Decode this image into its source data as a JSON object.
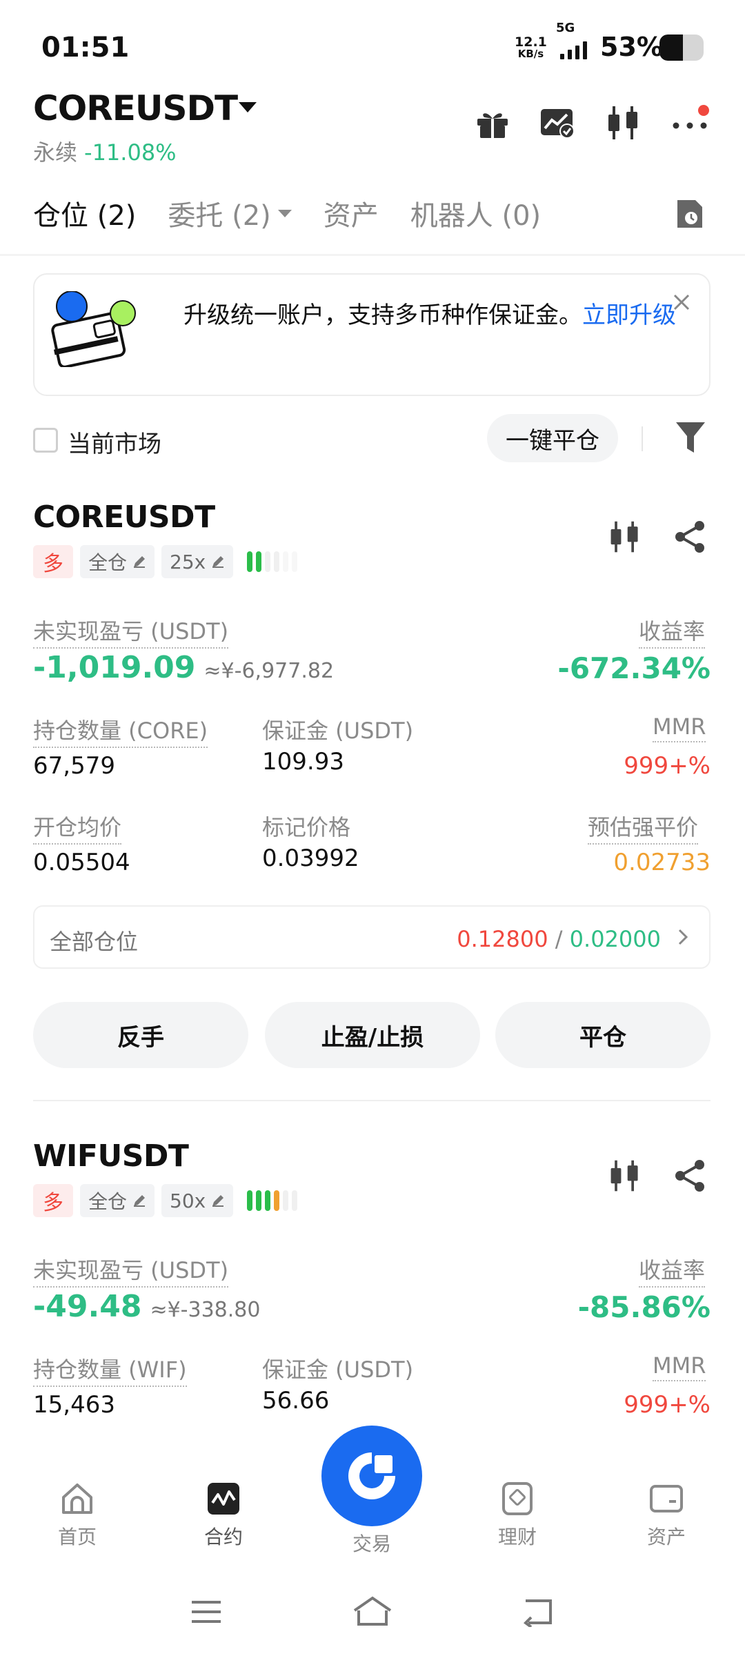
{
  "status_bar": {
    "time": "01:51",
    "net_speed_value": "12.1",
    "net_speed_unit": "KB/s",
    "network": "5G",
    "battery": "53%",
    "battery_level": 0.53
  },
  "header": {
    "pair": "COREUSDT",
    "contract_type": "永续",
    "change": "-11.08%"
  },
  "tabs": {
    "positions": "仓位 (2)",
    "orders": "委托 (2)",
    "assets": "资产",
    "bots": "机器人 (0)"
  },
  "banner": {
    "text": "升级统一账户，支持多币种作保证金。",
    "link": "立即升级"
  },
  "filter": {
    "current_market": "当前市场",
    "close_all": "一键平仓"
  },
  "positions": [
    {
      "symbol": "COREUSDT",
      "side": "多",
      "margin_mode": "全仓",
      "leverage": "25x",
      "risk_bars": 2,
      "unrealized_pnl_label": "未实现盈亏 (USDT)",
      "unrealized_pnl": "-1,019.09",
      "unrealized_pnl_cny": "≈¥-6,977.82",
      "roe_label": "收益率",
      "roe": "-672.34%",
      "qty_label": "持仓数量 (CORE)",
      "qty": "67,579",
      "margin_label": "保证金 (USDT)",
      "margin": "109.93",
      "mmr_label": "MMR",
      "mmr": "999+%",
      "entry_label": "开仓均价",
      "entry": "0.05504",
      "mark_label": "标记价格",
      "mark": "0.03992",
      "liq_label": "预估强平价",
      "liq": "0.02733",
      "all_positions_label": "全部仓位",
      "all_tp": "0.12800",
      "all_sl": "0.02000",
      "btn_reverse": "反手",
      "btn_tpsl": "止盈/止损",
      "btn_close": "平仓"
    },
    {
      "symbol": "WIFUSDT",
      "side": "多",
      "margin_mode": "全仓",
      "leverage": "50x",
      "risk_bars": 4,
      "unrealized_pnl_label": "未实现盈亏 (USDT)",
      "unrealized_pnl": "-49.48",
      "unrealized_pnl_cny": "≈¥-338.80",
      "roe_label": "收益率",
      "roe": "-85.86%",
      "qty_label": "持仓数量 (WIF)",
      "qty": "15,463",
      "margin_label": "保证金 (USDT)",
      "margin": "56.66",
      "mmr_label": "MMR",
      "mmr": "999+%"
    }
  ],
  "bottom_nav": {
    "home": "首页",
    "futures": "合约",
    "trade": "交易",
    "earn": "理财",
    "assets": "资产"
  },
  "colors": {
    "green": "#2ebd85",
    "red": "#f0483e",
    "orange": "#f0a030",
    "blue": "#1a6bf0"
  }
}
